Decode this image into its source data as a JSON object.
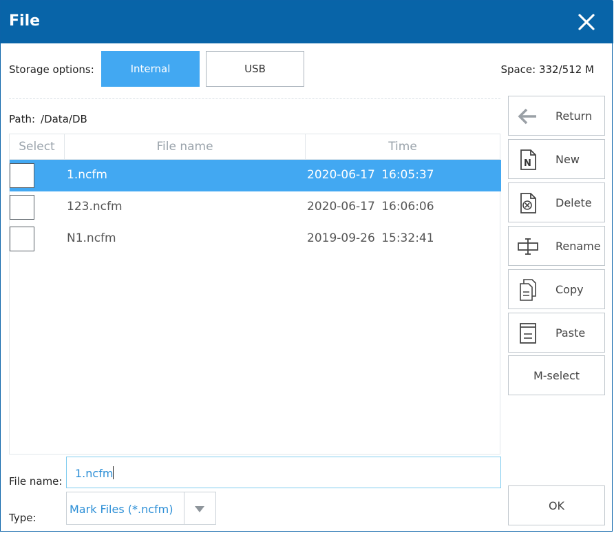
{
  "window": {
    "title": "File",
    "close_icon": "close-icon"
  },
  "storage": {
    "label": "Storage options:",
    "options": [
      {
        "label": "Internal",
        "selected": true
      },
      {
        "label": "USB",
        "selected": false
      }
    ],
    "space_label": "Space:  332/512  M"
  },
  "path": {
    "label": "Path:",
    "value": "/Data/DB"
  },
  "table": {
    "columns": [
      "Select",
      "File name",
      "Time"
    ],
    "rows": [
      {
        "name": "1.ncfm",
        "time": "2020-06-17  16:05:37",
        "selected": true
      },
      {
        "name": "123.ncfm",
        "time": "2020-06-17  16:06:06",
        "selected": false
      },
      {
        "name": "N1.ncfm",
        "time": "2019-09-26  15:32:41",
        "selected": false
      }
    ]
  },
  "side_buttons": {
    "return": {
      "label": "Return",
      "icon": "arrow-left-icon"
    },
    "new": {
      "label": "New",
      "icon": "new-file-icon"
    },
    "delete": {
      "label": "Delete",
      "icon": "delete-file-icon"
    },
    "rename": {
      "label": "Rename",
      "icon": "rename-icon"
    },
    "copy": {
      "label": "Copy",
      "icon": "copy-icon"
    },
    "paste": {
      "label": "Paste",
      "icon": "paste-icon"
    },
    "mselect": {
      "label": "M-select"
    }
  },
  "footer": {
    "file_name_label": "File name:",
    "file_name_value": "1.ncfm",
    "type_label": "Type:",
    "type_value": "Mark Files (*.ncfm)",
    "ok_label": "OK"
  },
  "colors": {
    "titlebar": "#0864a8",
    "accent": "#42a8f2",
    "input_text": "#2b8ed6"
  }
}
